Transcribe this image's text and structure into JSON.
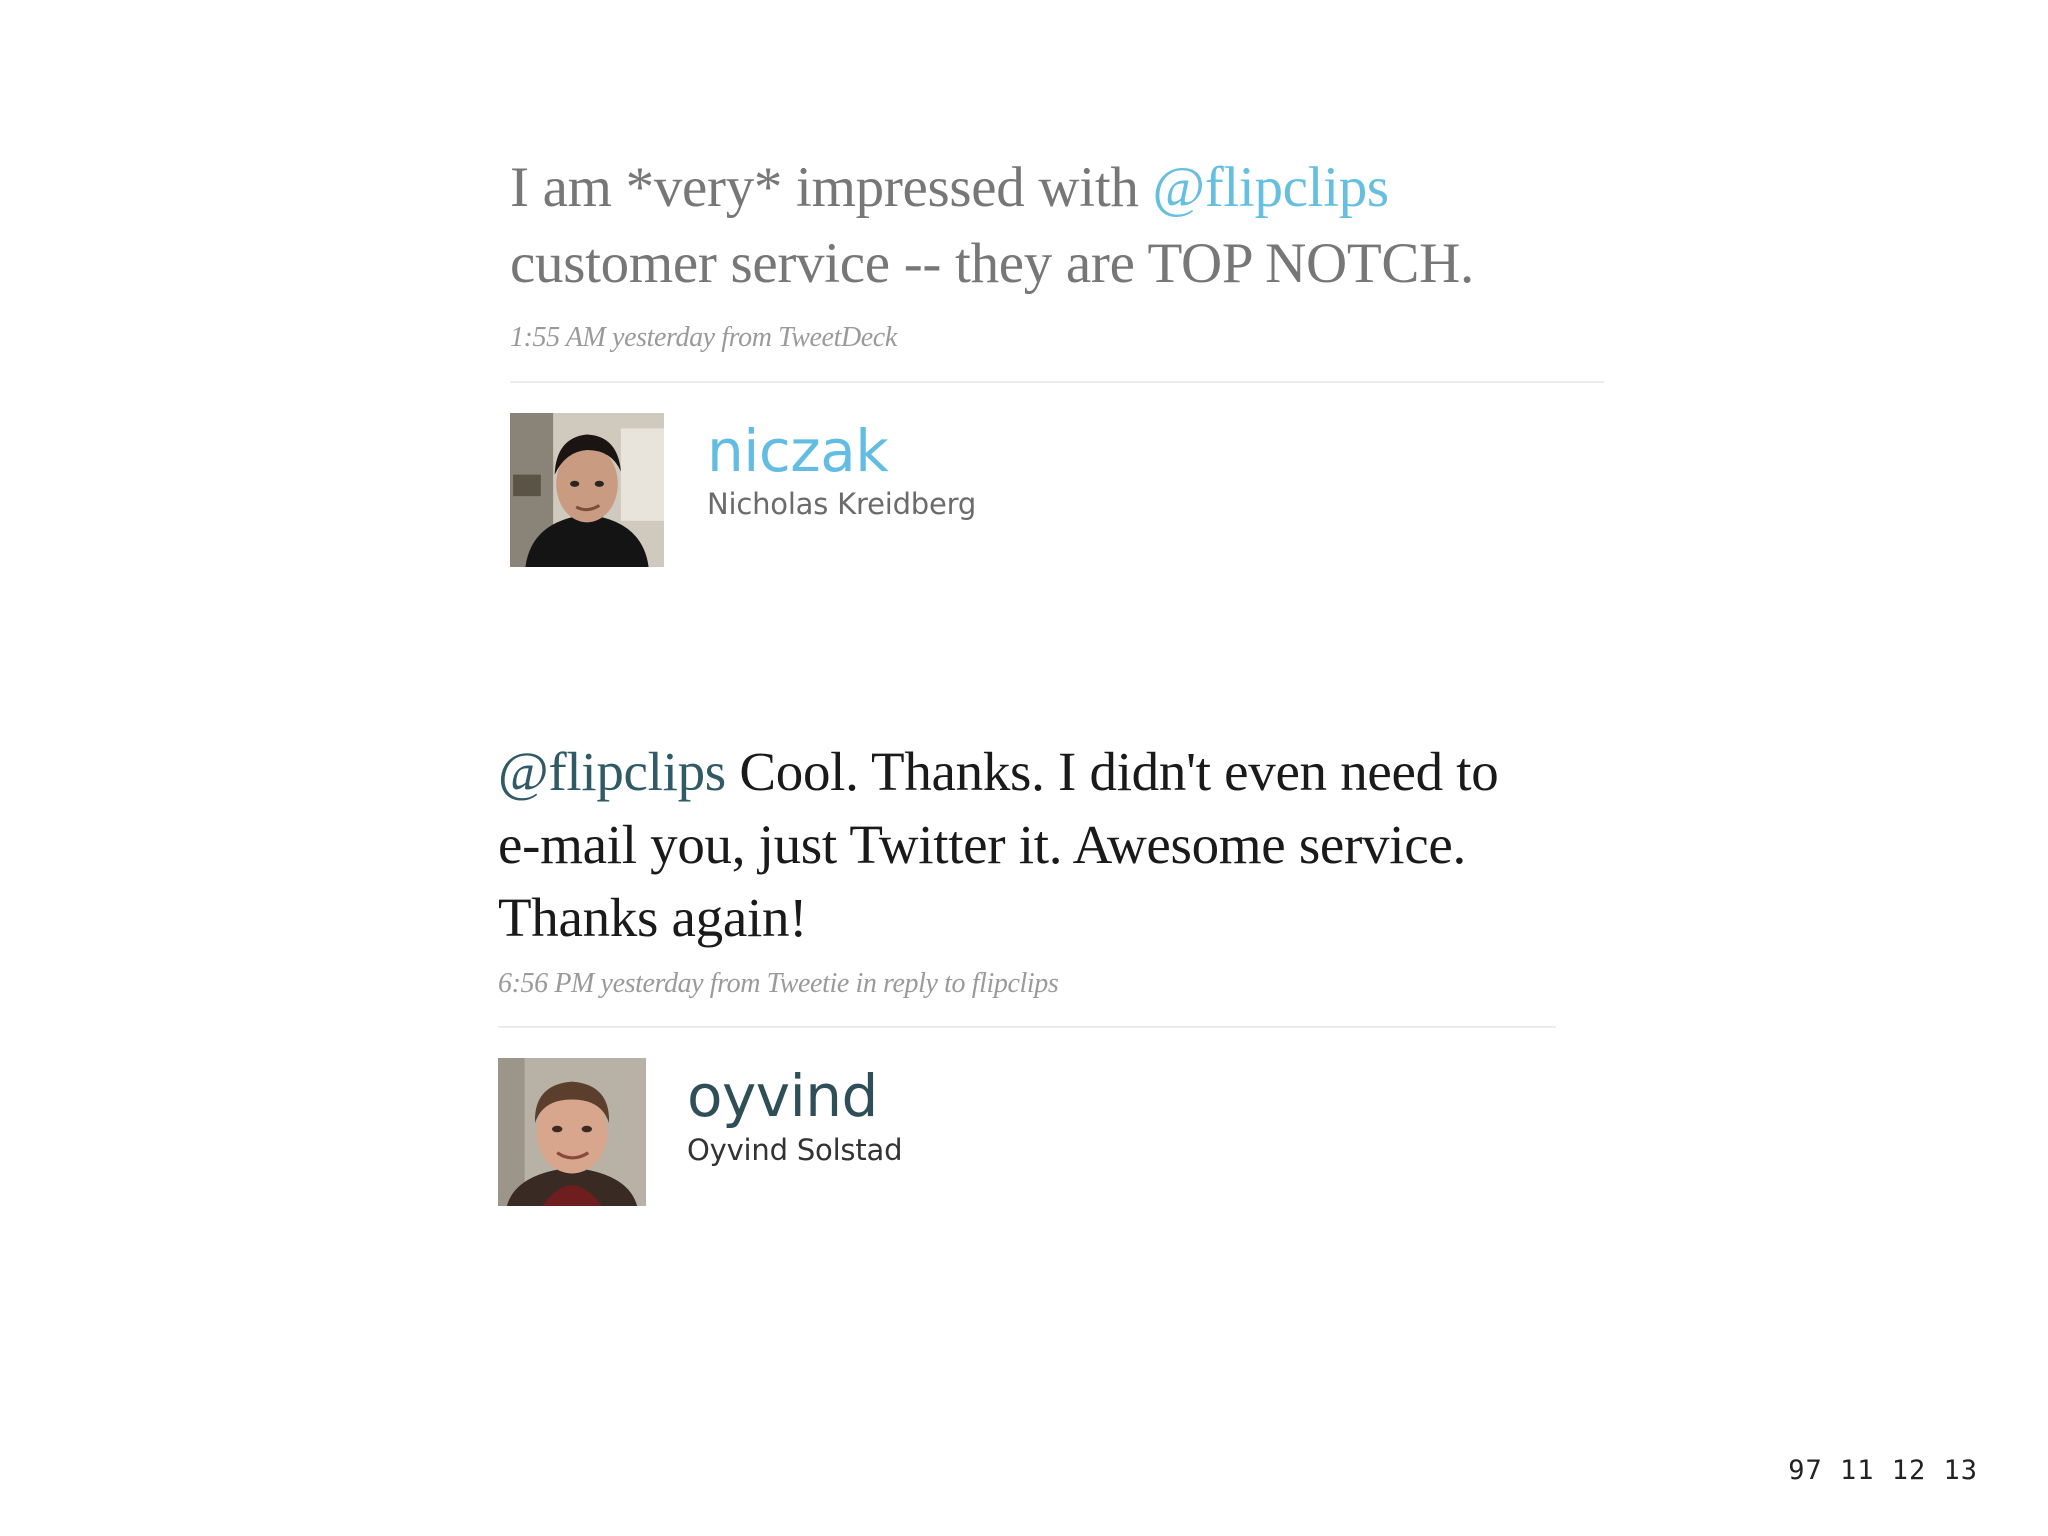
{
  "tweets": [
    {
      "text_before": "I am *very* impressed with ",
      "mention": "@flipclips",
      "text_after": " customer service -- they are TOP NOTCH.",
      "meta": "1:55 AM yesterday from TweetDeck",
      "screen_name": "niczak",
      "full_name": "Nicholas Kreidberg",
      "avatar_icon": "user-photo-icon",
      "mention_color": "#66bfe0"
    },
    {
      "text_before": "",
      "mention": "@flipclips",
      "text_after": " Cool. Thanks. I didn't even need to e-mail you, just Twitter it. Awesome service. Thanks again!",
      "meta": "6:56 PM yesterday from Tweetie in reply to flipclips",
      "screen_name": "oyvind",
      "full_name": "Oyvind Solstad",
      "avatar_icon": "user-photo-icon",
      "mention_color": "#2f5a66"
    }
  ],
  "slide_number": "97 11 12 13"
}
